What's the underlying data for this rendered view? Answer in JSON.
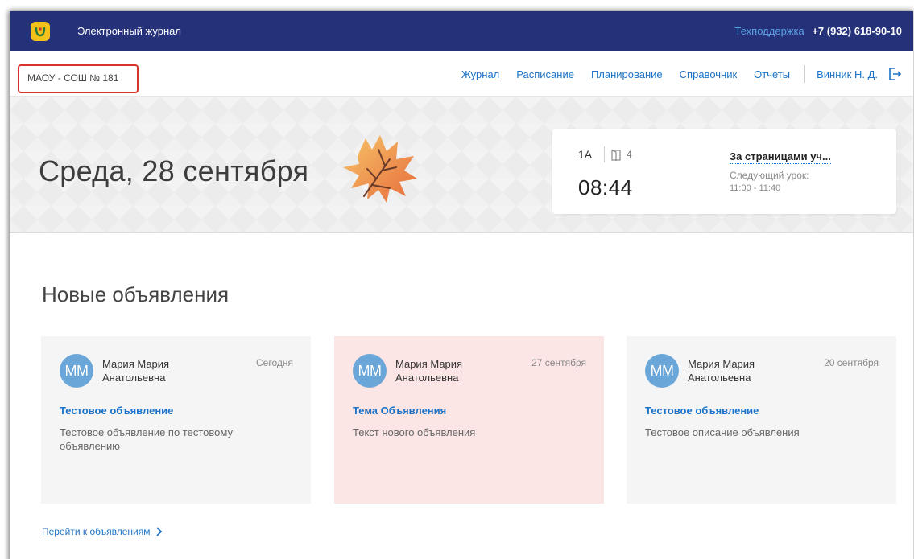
{
  "header": {
    "app_title": "Электронный журнал",
    "support_label": "Техподдержка",
    "support_phone": "+7 (932) 618-90-10"
  },
  "nav": {
    "school": "МАОУ - СОШ № 181",
    "links": [
      "Журнал",
      "Расписание",
      "Планирование",
      "Справочник",
      "Отчеты"
    ],
    "user": "Винник Н. Д."
  },
  "hero": {
    "date": "Среда, 28 сентября",
    "lesson": {
      "class": "1А",
      "room": "4",
      "time": "08:44",
      "subject": "За страницами уч...",
      "next_label": "Следующий урок:",
      "next_time": "11:00 - 11:40"
    }
  },
  "announcements": {
    "title": "Новые объявления",
    "items": [
      {
        "initials": "ММ",
        "author_line1": "Мария Мария",
        "author_line2": "Анатольевна",
        "date": "Сегодня",
        "title": "Тестовое объявление",
        "text": "Тестовое объявление по тестовому объявлению"
      },
      {
        "initials": "ММ",
        "author_line1": "Мария Мария",
        "author_line2": "Анатольевна",
        "date": "27 сентября",
        "title": "Тема Объявления",
        "text": "Текст нового объявления"
      },
      {
        "initials": "ММ",
        "author_line1": "Мария Мария",
        "author_line2": "Анатольевна",
        "date": "20 сентября",
        "title": "Тестовое объявление",
        "text": "Тестовое описание объявления"
      }
    ],
    "all_link": "Перейти к объявлениям"
  },
  "colors": {
    "topbar": "#25327a",
    "link": "#1d73c7",
    "highlight_border": "#d9342b",
    "pink_card": "#fbe5e5",
    "avatar": "#6aa6d8"
  },
  "icons": [
    "app-logo-icon",
    "exit-icon",
    "door-icon",
    "maple-leaf-icon",
    "chevron-right-icon"
  ]
}
